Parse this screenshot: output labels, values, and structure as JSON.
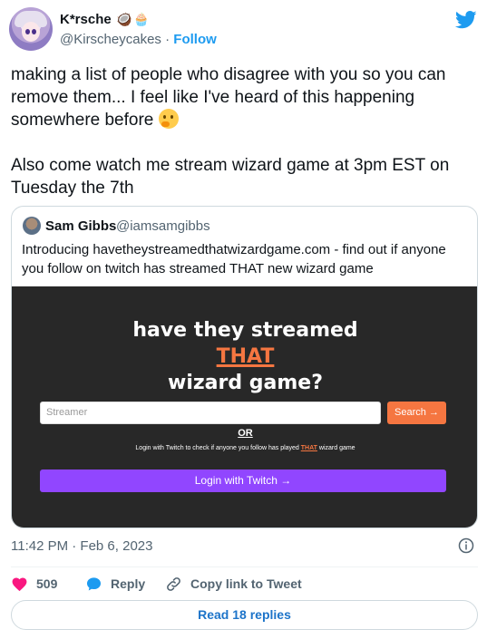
{
  "author": {
    "name": "K*rsche",
    "emojis": [
      "🥥",
      "🧁"
    ],
    "handle": "@Kirscheycakes",
    "separator": "·",
    "follow_label": "Follow"
  },
  "tweet": {
    "lines": [
      "making a list of people who disagree with you so you can remove them... I feel like I've heard of this happening somewhere before",
      "Also come watch me stream wizard game at 3pm EST on Tuesday the 7th"
    ],
    "emoji": "thinking-face-emoji"
  },
  "quoted": {
    "name": "Sam Gibbs",
    "handle": "@iamsamgibbs",
    "text": "Introducing havetheystreamedthatwizardgame.com - find out if anyone you follow on twitch has streamed THAT new wizard game",
    "preview": {
      "headline_1": "have they streamed",
      "headline_accent": "THAT",
      "headline_2": "wizard game?",
      "input_placeholder": "Streamer",
      "search_label": "Search →",
      "or_label": "OR",
      "note_before": "Login with Twitch to check if anyone you follow has played",
      "note_accent": "THAT",
      "note_after": "wizard game",
      "login_label": "Login with Twitch →",
      "colors": {
        "background": "#282828",
        "accent": "#f57641",
        "twitch": "#9146ff"
      }
    }
  },
  "meta": {
    "timestamp": "11:42 PM · Feb 6, 2023"
  },
  "actions": {
    "like_count": "509",
    "reply_label": "Reply",
    "copy_label": "Copy link to Tweet",
    "read_replies": "Read 18 replies"
  },
  "colors": {
    "twitter_blue": "#1d9bf0",
    "like_red": "#f91880"
  }
}
